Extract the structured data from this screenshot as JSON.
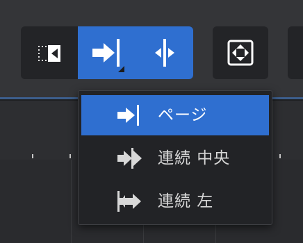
{
  "toolbar": {
    "mode_buttons": [
      {
        "icon": "sidebar-collapse-icon",
        "active": false
      },
      {
        "icon": "page-scroll-icon",
        "active": true
      },
      {
        "icon": "continuous-center-scroll-icon",
        "active": true
      }
    ],
    "fit_button": {
      "icon": "fit-screen-icon"
    }
  },
  "dropdown": {
    "items": [
      {
        "label": "ページ",
        "icon": "page-scroll-icon",
        "selected": true
      },
      {
        "label": "連続 中央",
        "icon": "continuous-center-scroll-icon",
        "selected": false
      },
      {
        "label": "連続 左",
        "icon": "continuous-left-scroll-icon",
        "selected": false
      }
    ]
  },
  "colors": {
    "accent": "#2f6fd0",
    "background": "#2b2c2f",
    "toolbar": "#343538",
    "button_bg": "#232427",
    "menu_bg": "#222326",
    "icon_white": "#ffffff"
  }
}
